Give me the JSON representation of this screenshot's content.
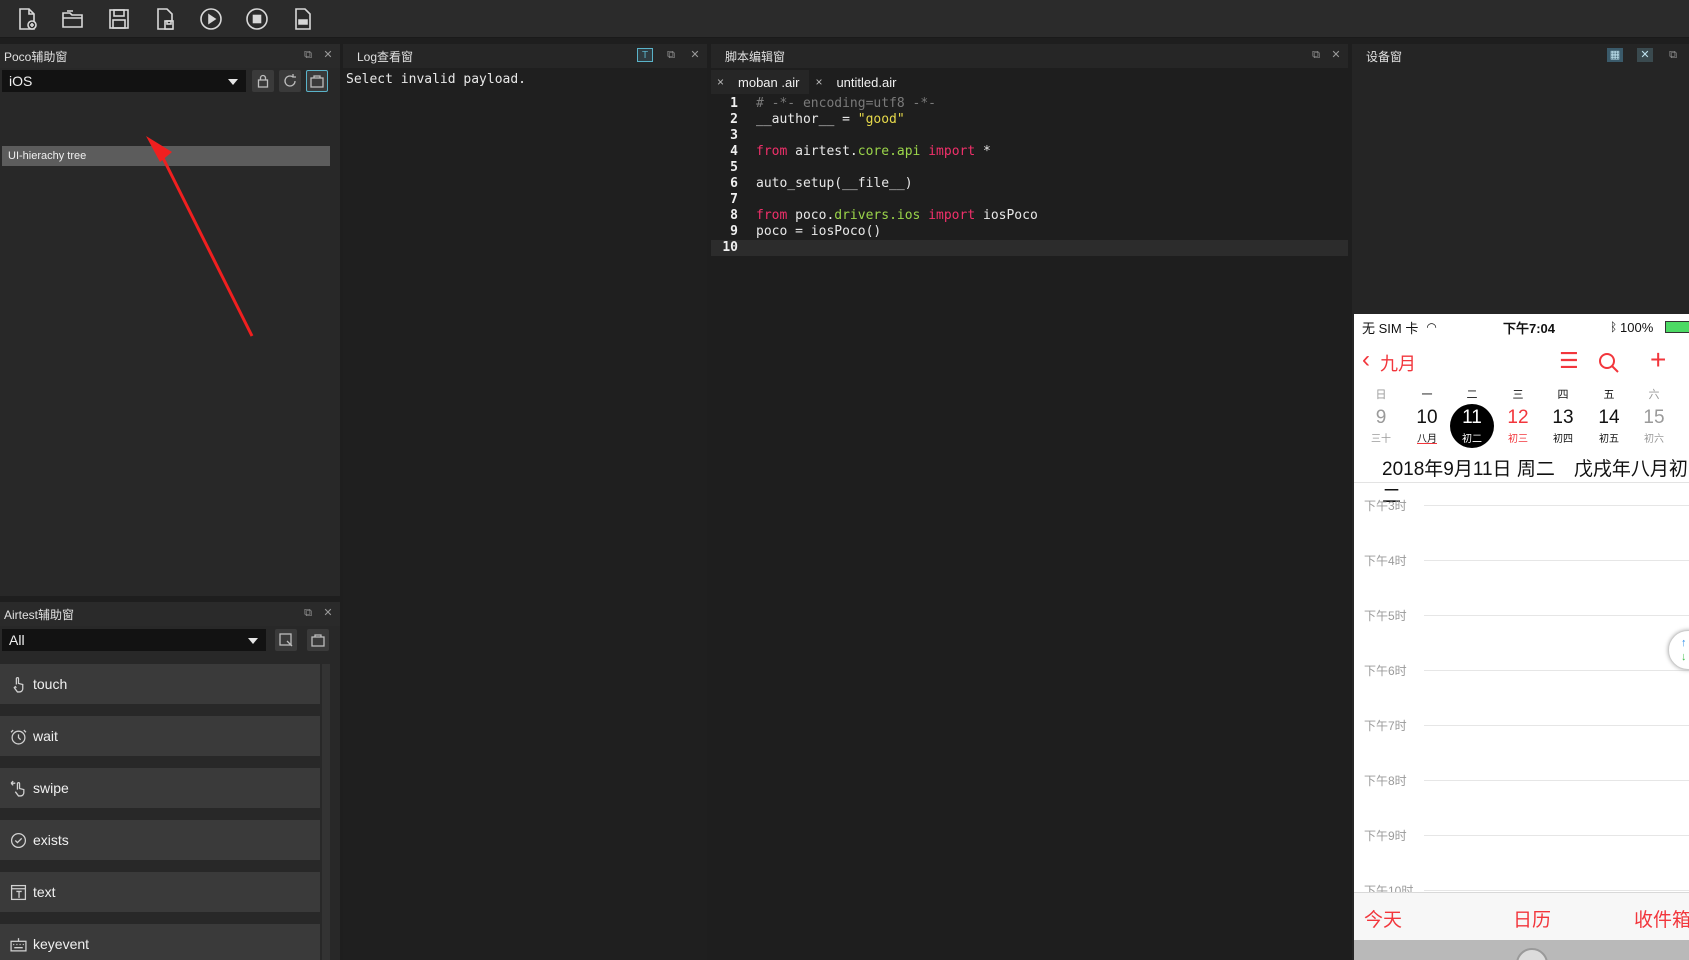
{
  "toolbar": {
    "buttons": [
      "new-file-icon",
      "open-folder-icon",
      "save-icon",
      "save-as-icon",
      "run-icon",
      "stop-icon",
      "log-icon"
    ]
  },
  "poco": {
    "title": "Poco辅助窗",
    "platform": "iOS",
    "tree_item": "UI-hierachy tree"
  },
  "airtest": {
    "title": "Airtest辅助窗",
    "filter": "All",
    "actions": [
      {
        "label": "touch",
        "icon": "hand-icon"
      },
      {
        "label": "wait",
        "icon": "clock-icon"
      },
      {
        "label": "swipe",
        "icon": "swipe-icon"
      },
      {
        "label": "exists",
        "icon": "check-circle-icon"
      },
      {
        "label": "text",
        "icon": "text-icon"
      },
      {
        "label": "keyevent",
        "icon": "keyboard-icon"
      }
    ]
  },
  "log": {
    "title": "Log查看窗",
    "message": "Select invalid payload."
  },
  "editor": {
    "title": "脚本编辑窗",
    "tabs": [
      {
        "label": "moban .air",
        "close": "×"
      },
      {
        "label": "untitled.air",
        "close": "×"
      }
    ],
    "lines": [
      {
        "n": "1",
        "parts": [
          [
            "c-comment",
            "# -*- encoding=utf8 -*-"
          ]
        ]
      },
      {
        "n": "2",
        "parts": [
          [
            "",
            "__author__ = "
          ],
          [
            "c-str",
            "\"good\""
          ]
        ]
      },
      {
        "n": "3",
        "parts": []
      },
      {
        "n": "4",
        "parts": [
          [
            "c-kw",
            "from"
          ],
          [
            "",
            " airtest."
          ],
          [
            "c-mod",
            "core.api"
          ],
          [
            "",
            " "
          ],
          [
            "c-kw",
            "import"
          ],
          [
            "",
            " *"
          ]
        ]
      },
      {
        "n": "5",
        "parts": []
      },
      {
        "n": "6",
        "parts": [
          [
            "",
            "auto_setup(__file__)"
          ]
        ]
      },
      {
        "n": "7",
        "parts": []
      },
      {
        "n": "8",
        "parts": [
          [
            "c-kw",
            "from"
          ],
          [
            "",
            " poco."
          ],
          [
            "c-mod",
            "drivers.ios"
          ],
          [
            "",
            " "
          ],
          [
            "c-kw",
            "import"
          ],
          [
            "",
            " iosPoco"
          ]
        ]
      },
      {
        "n": "9",
        "parts": [
          [
            "",
            "poco = iosPoco()"
          ]
        ]
      },
      {
        "n": "10",
        "parts": []
      }
    ]
  },
  "device": {
    "title": "设备窗",
    "phone": {
      "carrier": "无 SIM 卡",
      "time": "下午7:04",
      "battery": "100%",
      "back_label": "九月",
      "weekdays": [
        "日",
        "一",
        "二",
        "三",
        "四",
        "五",
        "六"
      ],
      "dates": [
        {
          "d": "9",
          "l": "三十"
        },
        {
          "d": "10",
          "l": "八月"
        },
        {
          "d": "11",
          "l": "初二"
        },
        {
          "d": "12",
          "l": "初三"
        },
        {
          "d": "13",
          "l": "初四"
        },
        {
          "d": "14",
          "l": "初五"
        },
        {
          "d": "15",
          "l": "初六"
        }
      ],
      "full_date": "2018年9月11日 周二　戊戌年八月初二",
      "hours": [
        "下午3时",
        "下午4时",
        "下午5时",
        "下午6时",
        "下午7时",
        "下午8时",
        "下午9时",
        "下午10时"
      ],
      "tabs": [
        "今天",
        "日历",
        "收件箱"
      ]
    }
  }
}
